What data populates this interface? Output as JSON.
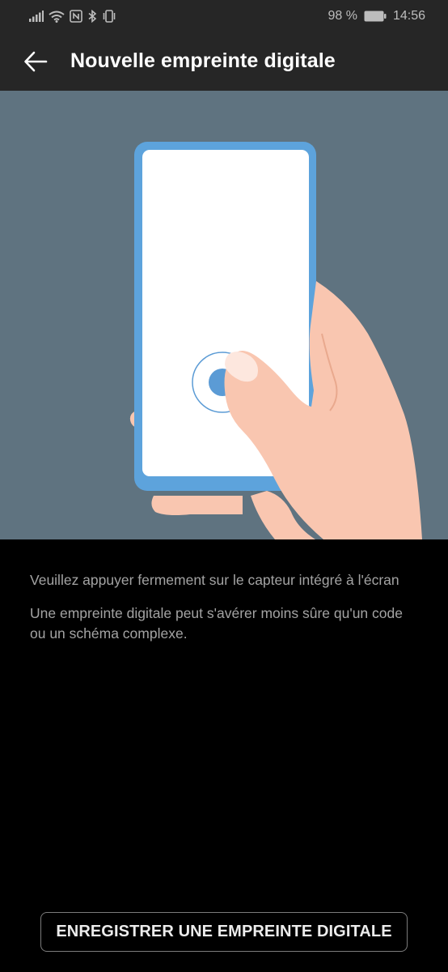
{
  "status_bar": {
    "battery": "98 %",
    "time": "14:56",
    "icons": [
      "signal-icon",
      "wifi-icon",
      "nfc-icon",
      "bluetooth-icon",
      "vibrate-icon",
      "battery-icon"
    ]
  },
  "app_bar": {
    "back_icon": "arrow-left-icon",
    "title": "Nouvelle empreinte digitale"
  },
  "illustration": {
    "description_icon": "fingerprint-sensor-illustration",
    "colors": {
      "background": "#5f7380",
      "phone_frame": "#5da3dc",
      "phone_screen": "#ffffff",
      "skin": "#f9c6b0",
      "sensor": "#5b9bd5"
    }
  },
  "instructions": {
    "primary": "Veuillez appuyer fermement sur le capteur intégré à l'écran",
    "secondary": "Une empreinte digitale peut s'avérer moins sûre qu'un code ou un schéma complexe."
  },
  "actions": {
    "enroll_label": "ENREGISTRER UNE EMPREINTE DIGITALE"
  }
}
